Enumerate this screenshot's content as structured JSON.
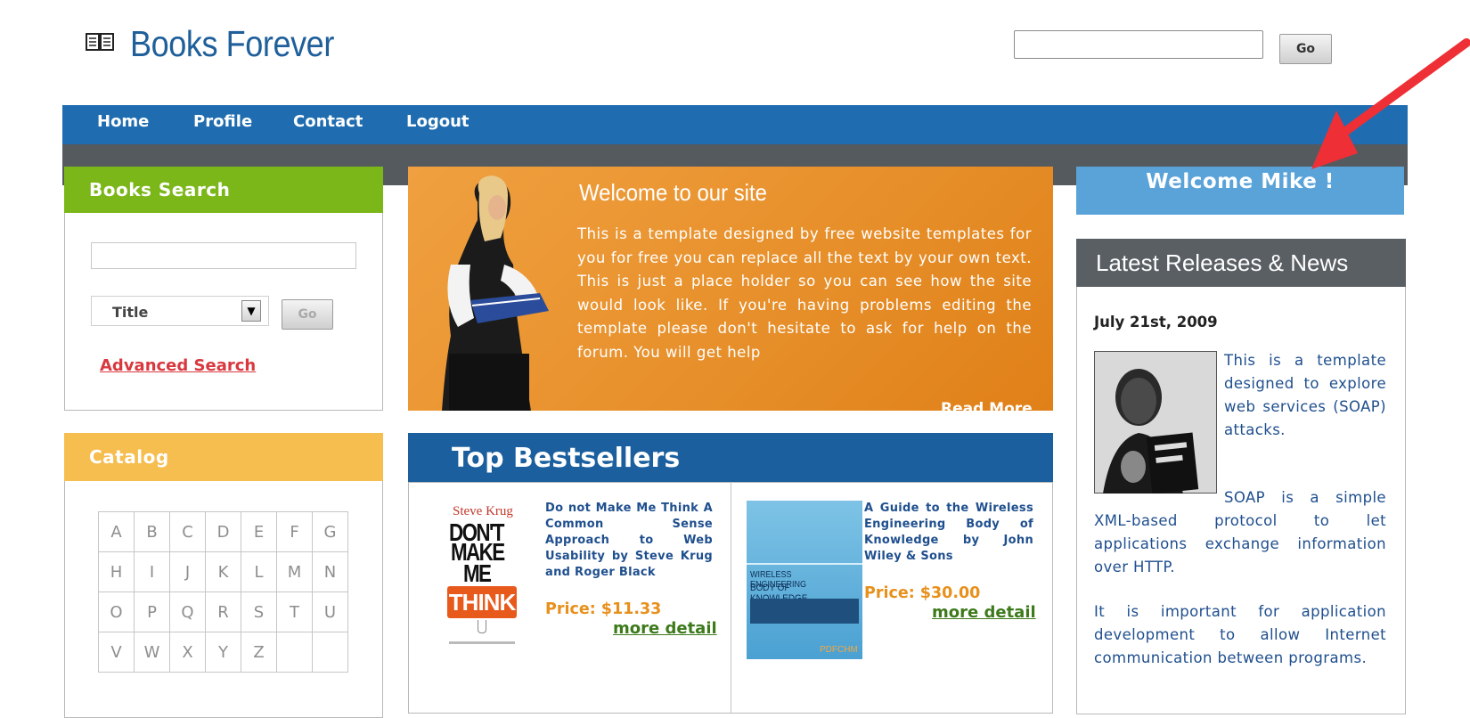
{
  "site": {
    "title": "Books Forever"
  },
  "header_search": {
    "value": "",
    "go_label": "Go"
  },
  "nav": {
    "items": [
      "Home",
      "Profile",
      "Contact",
      "Logout"
    ]
  },
  "books_search": {
    "title": "Books Search",
    "query": "",
    "select_value": "Title",
    "go_label": "Go",
    "advanced_link": "Advanced Search"
  },
  "catalog": {
    "title": "Catalog",
    "rows": [
      [
        "A",
        "B",
        "C",
        "D",
        "E",
        "F",
        "G"
      ],
      [
        "H",
        "I",
        "J",
        "K",
        "L",
        "M",
        "N"
      ],
      [
        "O",
        "P",
        "Q",
        "R",
        "S",
        "T",
        "U"
      ],
      [
        "V",
        "W",
        "X",
        "Y",
        "Z",
        "",
        ""
      ]
    ]
  },
  "welcome_banner": {
    "title": "Welcome to our site",
    "body": "This is a template designed by free website templates for you for free you can replace all the text by your own text. This is just a place holder so you can see how the site would look like. If you're having problems editing the template please don't hesitate to ask for help on the forum. You will get help",
    "read_more": "Read More"
  },
  "bestsellers": {
    "title": "Top Bestsellers",
    "books": [
      {
        "description": "Do not Make Me Think A Common Sense Approach to Web Usability by Steve Krug and Roger Black",
        "price": "Price: $11.33",
        "more": "more detail",
        "cover": {
          "author": "Steve Krug",
          "l1": "DON'T",
          "l2": "MAKE",
          "l3": "ME",
          "l4": "THINK"
        }
      },
      {
        "description": "A Guide to the Wireless Engineering Body of Knowledge by John Wiley & Sons",
        "price": "Price: $30.00",
        "more": "more detail",
        "cover": {
          "l1": "WIRELESS ENGINEERING",
          "l2": "BODY OF KNOWLEDGE",
          "l3": "PDFCHM"
        }
      }
    ]
  },
  "user": {
    "welcome": "Welcome Mike !"
  },
  "news": {
    "title": "Latest Releases & News",
    "date": "July 21st, 2009",
    "p1": "This is a template designed to explore web services (SOAP) attacks.",
    "p2": "SOAP is a simple XML-based protocol to let applications exchange information over HTTP.",
    "p3": "It is important for application development to allow Internet communication between programs."
  },
  "colors": {
    "nav_blue": "#1f6db0",
    "search_green": "#7cb71a",
    "catalog_orange": "#f6bd4f",
    "banner_orange": "#e7902b",
    "welcome_blue": "#5aa3d9",
    "arrow_red": "#ee2f35"
  }
}
